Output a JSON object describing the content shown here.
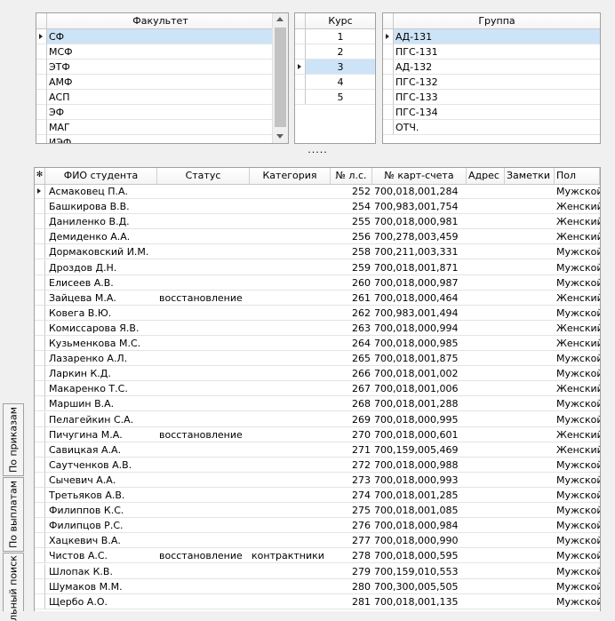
{
  "faculty": {
    "header": "Факультет",
    "items": [
      "СФ",
      "МСФ",
      "ЭТФ",
      "АМФ",
      "АСП",
      "ЭФ",
      "МАГ",
      "ИЭФ"
    ],
    "selected": 0
  },
  "course": {
    "header": "Курс",
    "items": [
      "1",
      "2",
      "3",
      "4",
      "5"
    ],
    "selected": 2
  },
  "group": {
    "header": "Группа",
    "items": [
      "АД-131",
      "ПГС-131",
      "АД-132",
      "ПГС-132",
      "ПГС-133",
      "ПГС-134",
      "ОТЧ."
    ],
    "selected": 0
  },
  "splitter": {
    "label": "....."
  },
  "students": {
    "columns": [
      "ФИО студента",
      "Статус",
      "Категория",
      "№ л.с.",
      "№ карт-счета",
      "Адрес",
      "Заметки",
      "Пол"
    ],
    "rows": [
      [
        "Асмаковец П.А.",
        "",
        "",
        "252",
        "700,018,001,284",
        "",
        "",
        "Мужской"
      ],
      [
        "Башкирова В.В.",
        "",
        "",
        "254",
        "700,983,001,754",
        "",
        "",
        "Женский"
      ],
      [
        "Даниленко В.Д.",
        "",
        "",
        "255",
        "700,018,000,981",
        "",
        "",
        "Женский"
      ],
      [
        "Демиденко А.А.",
        "",
        "",
        "256",
        "700,278,003,459",
        "",
        "",
        "Женский"
      ],
      [
        "Дормаковский И.М.",
        "",
        "",
        "258",
        "700,211,003,331",
        "",
        "",
        "Мужской"
      ],
      [
        "Дроздов Д.Н.",
        "",
        "",
        "259",
        "700,018,001,871",
        "",
        "",
        "Мужской"
      ],
      [
        "Елисеев А.В.",
        "",
        "",
        "260",
        "700,018,000,987",
        "",
        "",
        "Мужской"
      ],
      [
        "Зайцева М.А.",
        "восстановление",
        "",
        "261",
        "700,018,000,464",
        "",
        "",
        "Женский"
      ],
      [
        "Ковега В.Ю.",
        "",
        "",
        "262",
        "700,983,001,494",
        "",
        "",
        "Мужской"
      ],
      [
        "Комиссарова Я.В.",
        "",
        "",
        "263",
        "700,018,000,994",
        "",
        "",
        "Женский"
      ],
      [
        "Кузьменкова М.С.",
        "",
        "",
        "264",
        "700,018,000,985",
        "",
        "",
        "Женский"
      ],
      [
        "Лазаренко А.Л.",
        "",
        "",
        "265",
        "700,018,001,875",
        "",
        "",
        "Мужской"
      ],
      [
        "Ларкин К.Д.",
        "",
        "",
        "266",
        "700,018,001,002",
        "",
        "",
        "Мужской"
      ],
      [
        "Макаренко Т.С.",
        "",
        "",
        "267",
        "700,018,001,006",
        "",
        "",
        "Женский"
      ],
      [
        "Маршин В.А.",
        "",
        "",
        "268",
        "700,018,001,288",
        "",
        "",
        "Мужской"
      ],
      [
        "Пелагейкин С.А.",
        "",
        "",
        "269",
        "700,018,000,995",
        "",
        "",
        "Мужской"
      ],
      [
        "Пичугина М.А.",
        "восстановление",
        "",
        "270",
        "700,018,000,601",
        "",
        "",
        "Женский"
      ],
      [
        "Савицкая А.А.",
        "",
        "",
        "271",
        "700,159,005,469",
        "",
        "",
        "Женский"
      ],
      [
        "Саутченков А.В.",
        "",
        "",
        "272",
        "700,018,000,988",
        "",
        "",
        "Мужской"
      ],
      [
        "Сычевич А.А.",
        "",
        "",
        "273",
        "700,018,000,993",
        "",
        "",
        "Мужской"
      ],
      [
        "Третьяков А.В.",
        "",
        "",
        "274",
        "700,018,001,285",
        "",
        "",
        "Мужской"
      ],
      [
        "Филиппов К.С.",
        "",
        "",
        "275",
        "700,018,001,085",
        "",
        "",
        "Мужской"
      ],
      [
        "Филипцов Р.С.",
        "",
        "",
        "276",
        "700,018,000,984",
        "",
        "",
        "Мужской"
      ],
      [
        "Хацкевич В.А.",
        "",
        "",
        "277",
        "700,018,000,990",
        "",
        "",
        "Мужской"
      ],
      [
        "Чистов А.С.",
        "восстановление",
        "контрактники",
        "278",
        "700,018,000,595",
        "",
        "",
        "Мужской"
      ],
      [
        "Шлопак К.В.",
        "",
        "",
        "279",
        "700,159,010,553",
        "",
        "",
        "Мужской"
      ],
      [
        "Шумаков М.М.",
        "",
        "",
        "280",
        "700,300,005,505",
        "",
        "",
        "Мужской"
      ],
      [
        "Щербо А.О.",
        "",
        "",
        "281",
        "700,018,001,135",
        "",
        "",
        "Мужской"
      ]
    ]
  },
  "side_tabs": [
    "По приказам",
    "По выплатам",
    "льный поиск"
  ]
}
